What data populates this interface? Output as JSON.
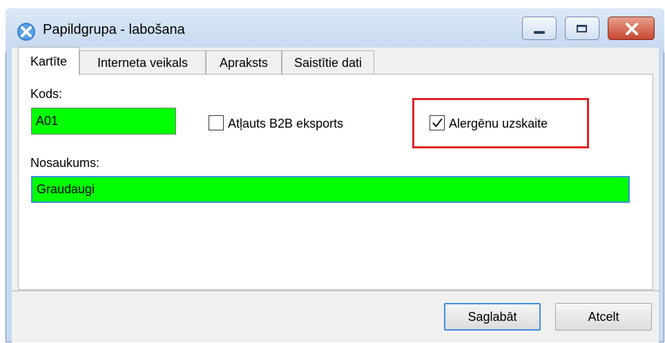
{
  "window": {
    "title": "Papildgrupa - labošana"
  },
  "tabs": [
    {
      "label": "Kartīte",
      "active": true
    },
    {
      "label": "Interneta veikals",
      "active": false
    },
    {
      "label": "Apraksts",
      "active": false
    },
    {
      "label": "Saistītie dati",
      "active": false
    }
  ],
  "form": {
    "kods_label": "Kods:",
    "kods_value": "A01",
    "b2b_label": "Atļauts B2B eksports",
    "b2b_checked": false,
    "alergenu_label": "Alergēnu uzskaite",
    "alergenu_checked": true,
    "nosaukums_label": "Nosaukums:",
    "nosaukums_value": "Graudaugi"
  },
  "buttons": {
    "save": "Saglabāt",
    "cancel": "Atcelt"
  },
  "colors": {
    "field_fill": "#00ff00",
    "highlight": "#e2222a",
    "focus": "#3a8fd8"
  }
}
